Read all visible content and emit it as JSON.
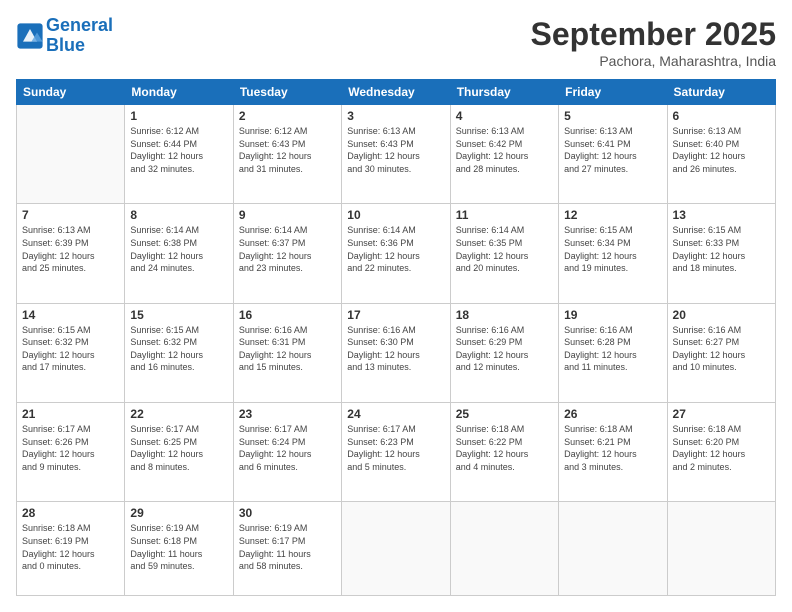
{
  "logo": {
    "line1": "General",
    "line2": "Blue"
  },
  "header": {
    "month": "September 2025",
    "location": "Pachora, Maharashtra, India"
  },
  "weekdays": [
    "Sunday",
    "Monday",
    "Tuesday",
    "Wednesday",
    "Thursday",
    "Friday",
    "Saturday"
  ],
  "weeks": [
    [
      {
        "day": "",
        "info": ""
      },
      {
        "day": "1",
        "info": "Sunrise: 6:12 AM\nSunset: 6:44 PM\nDaylight: 12 hours\nand 32 minutes."
      },
      {
        "day": "2",
        "info": "Sunrise: 6:12 AM\nSunset: 6:43 PM\nDaylight: 12 hours\nand 31 minutes."
      },
      {
        "day": "3",
        "info": "Sunrise: 6:13 AM\nSunset: 6:43 PM\nDaylight: 12 hours\nand 30 minutes."
      },
      {
        "day": "4",
        "info": "Sunrise: 6:13 AM\nSunset: 6:42 PM\nDaylight: 12 hours\nand 28 minutes."
      },
      {
        "day": "5",
        "info": "Sunrise: 6:13 AM\nSunset: 6:41 PM\nDaylight: 12 hours\nand 27 minutes."
      },
      {
        "day": "6",
        "info": "Sunrise: 6:13 AM\nSunset: 6:40 PM\nDaylight: 12 hours\nand 26 minutes."
      }
    ],
    [
      {
        "day": "7",
        "info": "Sunrise: 6:13 AM\nSunset: 6:39 PM\nDaylight: 12 hours\nand 25 minutes."
      },
      {
        "day": "8",
        "info": "Sunrise: 6:14 AM\nSunset: 6:38 PM\nDaylight: 12 hours\nand 24 minutes."
      },
      {
        "day": "9",
        "info": "Sunrise: 6:14 AM\nSunset: 6:37 PM\nDaylight: 12 hours\nand 23 minutes."
      },
      {
        "day": "10",
        "info": "Sunrise: 6:14 AM\nSunset: 6:36 PM\nDaylight: 12 hours\nand 22 minutes."
      },
      {
        "day": "11",
        "info": "Sunrise: 6:14 AM\nSunset: 6:35 PM\nDaylight: 12 hours\nand 20 minutes."
      },
      {
        "day": "12",
        "info": "Sunrise: 6:15 AM\nSunset: 6:34 PM\nDaylight: 12 hours\nand 19 minutes."
      },
      {
        "day": "13",
        "info": "Sunrise: 6:15 AM\nSunset: 6:33 PM\nDaylight: 12 hours\nand 18 minutes."
      }
    ],
    [
      {
        "day": "14",
        "info": "Sunrise: 6:15 AM\nSunset: 6:32 PM\nDaylight: 12 hours\nand 17 minutes."
      },
      {
        "day": "15",
        "info": "Sunrise: 6:15 AM\nSunset: 6:32 PM\nDaylight: 12 hours\nand 16 minutes."
      },
      {
        "day": "16",
        "info": "Sunrise: 6:16 AM\nSunset: 6:31 PM\nDaylight: 12 hours\nand 15 minutes."
      },
      {
        "day": "17",
        "info": "Sunrise: 6:16 AM\nSunset: 6:30 PM\nDaylight: 12 hours\nand 13 minutes."
      },
      {
        "day": "18",
        "info": "Sunrise: 6:16 AM\nSunset: 6:29 PM\nDaylight: 12 hours\nand 12 minutes."
      },
      {
        "day": "19",
        "info": "Sunrise: 6:16 AM\nSunset: 6:28 PM\nDaylight: 12 hours\nand 11 minutes."
      },
      {
        "day": "20",
        "info": "Sunrise: 6:16 AM\nSunset: 6:27 PM\nDaylight: 12 hours\nand 10 minutes."
      }
    ],
    [
      {
        "day": "21",
        "info": "Sunrise: 6:17 AM\nSunset: 6:26 PM\nDaylight: 12 hours\nand 9 minutes."
      },
      {
        "day": "22",
        "info": "Sunrise: 6:17 AM\nSunset: 6:25 PM\nDaylight: 12 hours\nand 8 minutes."
      },
      {
        "day": "23",
        "info": "Sunrise: 6:17 AM\nSunset: 6:24 PM\nDaylight: 12 hours\nand 6 minutes."
      },
      {
        "day": "24",
        "info": "Sunrise: 6:17 AM\nSunset: 6:23 PM\nDaylight: 12 hours\nand 5 minutes."
      },
      {
        "day": "25",
        "info": "Sunrise: 6:18 AM\nSunset: 6:22 PM\nDaylight: 12 hours\nand 4 minutes."
      },
      {
        "day": "26",
        "info": "Sunrise: 6:18 AM\nSunset: 6:21 PM\nDaylight: 12 hours\nand 3 minutes."
      },
      {
        "day": "27",
        "info": "Sunrise: 6:18 AM\nSunset: 6:20 PM\nDaylight: 12 hours\nand 2 minutes."
      }
    ],
    [
      {
        "day": "28",
        "info": "Sunrise: 6:18 AM\nSunset: 6:19 PM\nDaylight: 12 hours\nand 0 minutes."
      },
      {
        "day": "29",
        "info": "Sunrise: 6:19 AM\nSunset: 6:18 PM\nDaylight: 11 hours\nand 59 minutes."
      },
      {
        "day": "30",
        "info": "Sunrise: 6:19 AM\nSunset: 6:17 PM\nDaylight: 11 hours\nand 58 minutes."
      },
      {
        "day": "",
        "info": ""
      },
      {
        "day": "",
        "info": ""
      },
      {
        "day": "",
        "info": ""
      },
      {
        "day": "",
        "info": ""
      }
    ]
  ]
}
